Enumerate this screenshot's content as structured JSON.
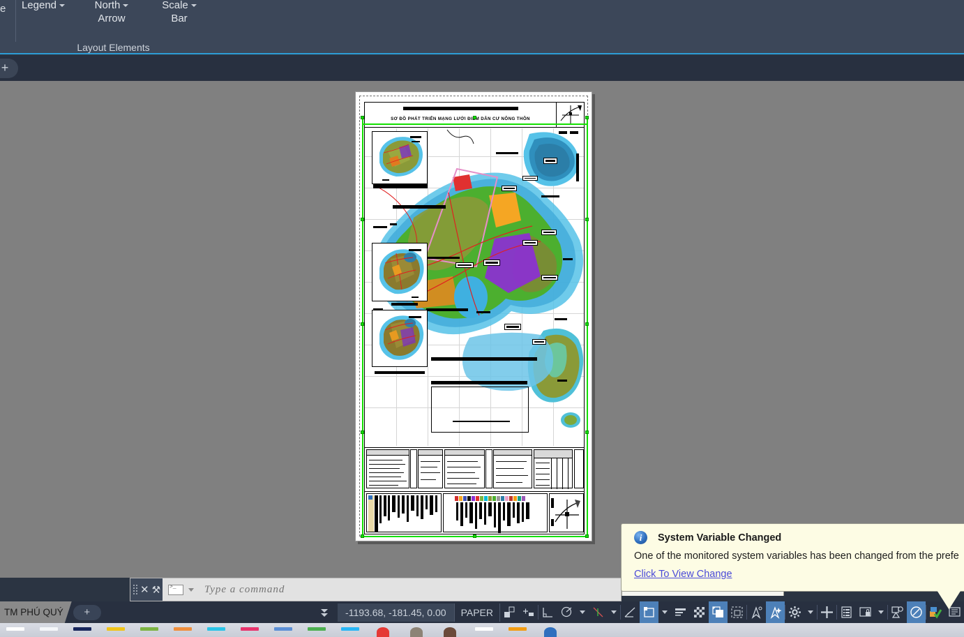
{
  "ribbon": {
    "edge_partial_label": "e",
    "buttons": [
      {
        "label_line1": "Legend",
        "label_line2": "",
        "name": "legend"
      },
      {
        "label_line1": "North",
        "label_line2": "Arrow",
        "name": "north-arrow"
      },
      {
        "label_line1": "Scale",
        "label_line2": "Bar",
        "name": "scale-bar"
      }
    ],
    "panel_title": "Layout Elements"
  },
  "command": {
    "placeholder": "Type a command",
    "value": "",
    "close_glyph": "✕",
    "wrench_glyph": "⚒"
  },
  "balloon": {
    "icon_glyph": "i",
    "title": "System Variable Changed",
    "body": "One of the monitored system variables has been changed from the prefe",
    "link": "Click To View Change"
  },
  "status": {
    "layout_tab": "TM PHÚ QUÝ",
    "add_layout": "+",
    "coordinates": "-1193.68, -181.45, 0.00",
    "space_mode": "PAPER",
    "icons": [
      {
        "name": "model-space-icon",
        "active": false
      },
      {
        "name": "snap-mode-icon",
        "active": false
      },
      {
        "name": "ortho-mode-icon",
        "active": false
      },
      {
        "name": "polar-tracking-icon",
        "active": false
      },
      {
        "name": "object-snap-toggle-icon",
        "active": false
      },
      {
        "name": "object-snap-tracking-icon",
        "active": false
      },
      {
        "name": "annotation-visibility-icon",
        "active": true
      },
      {
        "name": "lineweight-icon",
        "active": false
      },
      {
        "name": "transparency-icon",
        "active": false
      },
      {
        "name": "selection-cycling-icon",
        "active": true
      },
      {
        "name": "3d-object-snap-icon",
        "active": false
      },
      {
        "name": "dynamic-ucs-icon",
        "active": false
      },
      {
        "name": "selection-filter-icon",
        "active": true
      },
      {
        "name": "workspace-gear-icon",
        "active": false
      },
      {
        "name": "annotation-scale-icon",
        "active": false
      },
      {
        "name": "viewport-list-icon",
        "active": false
      },
      {
        "name": "viewport-lock-icon",
        "active": false
      },
      {
        "name": "isolate-objects-icon",
        "active": false
      },
      {
        "name": "graphics-performance-icon",
        "active": true
      },
      {
        "name": "clean-screen-icon",
        "active": false
      }
    ]
  },
  "drawing": {
    "title": "SƠ ĐỒ PHÁT TRIỂN MẠNG LƯỚI ĐIỂM DÂN CƯ NÔNG THÔN",
    "sheet_name": "TM PHÚ QUÝ"
  },
  "taskbar": {
    "items": [
      {
        "name": "start-icon",
        "color": "#ffffff"
      },
      {
        "name": "app-icon-1",
        "color": "#f5f7fa"
      },
      {
        "name": "app-icon-2",
        "color": "#17265c"
      },
      {
        "name": "app-icon-3",
        "color": "#f0c419"
      },
      {
        "name": "app-icon-4",
        "color": "#7cb342"
      },
      {
        "name": "app-icon-5",
        "color": "#ef8e3d"
      },
      {
        "name": "app-icon-6",
        "color": "#2bc4e8"
      },
      {
        "name": "app-icon-7",
        "color": "#e8336d"
      },
      {
        "name": "app-icon-8",
        "color": "#5c8fd6"
      },
      {
        "name": "app-icon-9",
        "color": "#4caf50"
      },
      {
        "name": "app-icon-10",
        "color": "#29b6f6"
      },
      {
        "name": "app-icon-11",
        "color": "#e53935"
      },
      {
        "name": "app-icon-12",
        "color": "#8d8376"
      },
      {
        "name": "app-icon-13",
        "color": "#6b4a3a"
      },
      {
        "name": "app-icon-14",
        "color": "#ffffff"
      },
      {
        "name": "app-icon-15",
        "color": "#f39c12"
      },
      {
        "name": "app-icon-16",
        "color": "#2f6fbe"
      }
    ]
  }
}
